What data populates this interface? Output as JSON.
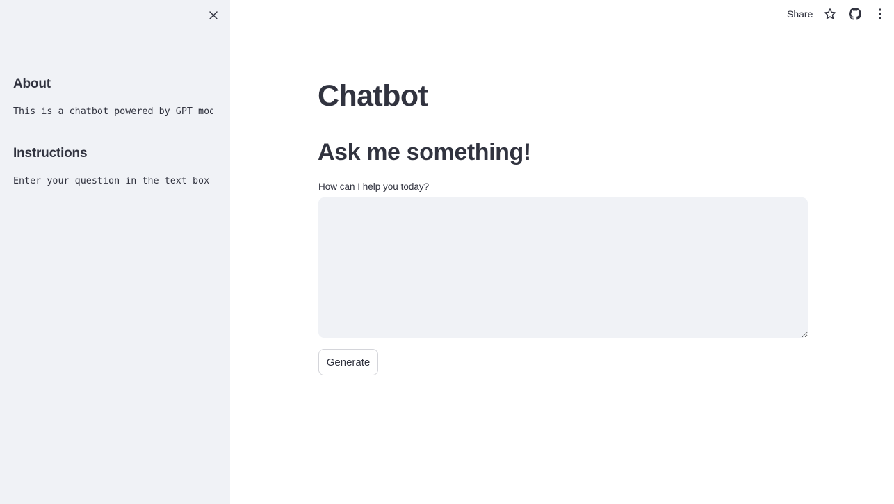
{
  "sidebar": {
    "close_icon": "close-icon",
    "sections": [
      {
        "title": "About",
        "code": "This is a chatbot powered by GPT model."
      },
      {
        "title": "Instructions",
        "code": "Enter your question in the text box below."
      }
    ]
  },
  "toolbar": {
    "share_label": "Share",
    "icons": [
      "star-icon",
      "github-icon",
      "kebab-menu-icon"
    ]
  },
  "main": {
    "title": "Chatbot",
    "subtitle": "Ask me something!",
    "input_label": "How can I help you today?",
    "input_value": "",
    "generate_label": "Generate"
  },
  "colors": {
    "sidebar_bg": "#f0f2f6",
    "text": "#31333f",
    "input_bg": "#f0f2f6",
    "button_border": "#d4d5da"
  }
}
